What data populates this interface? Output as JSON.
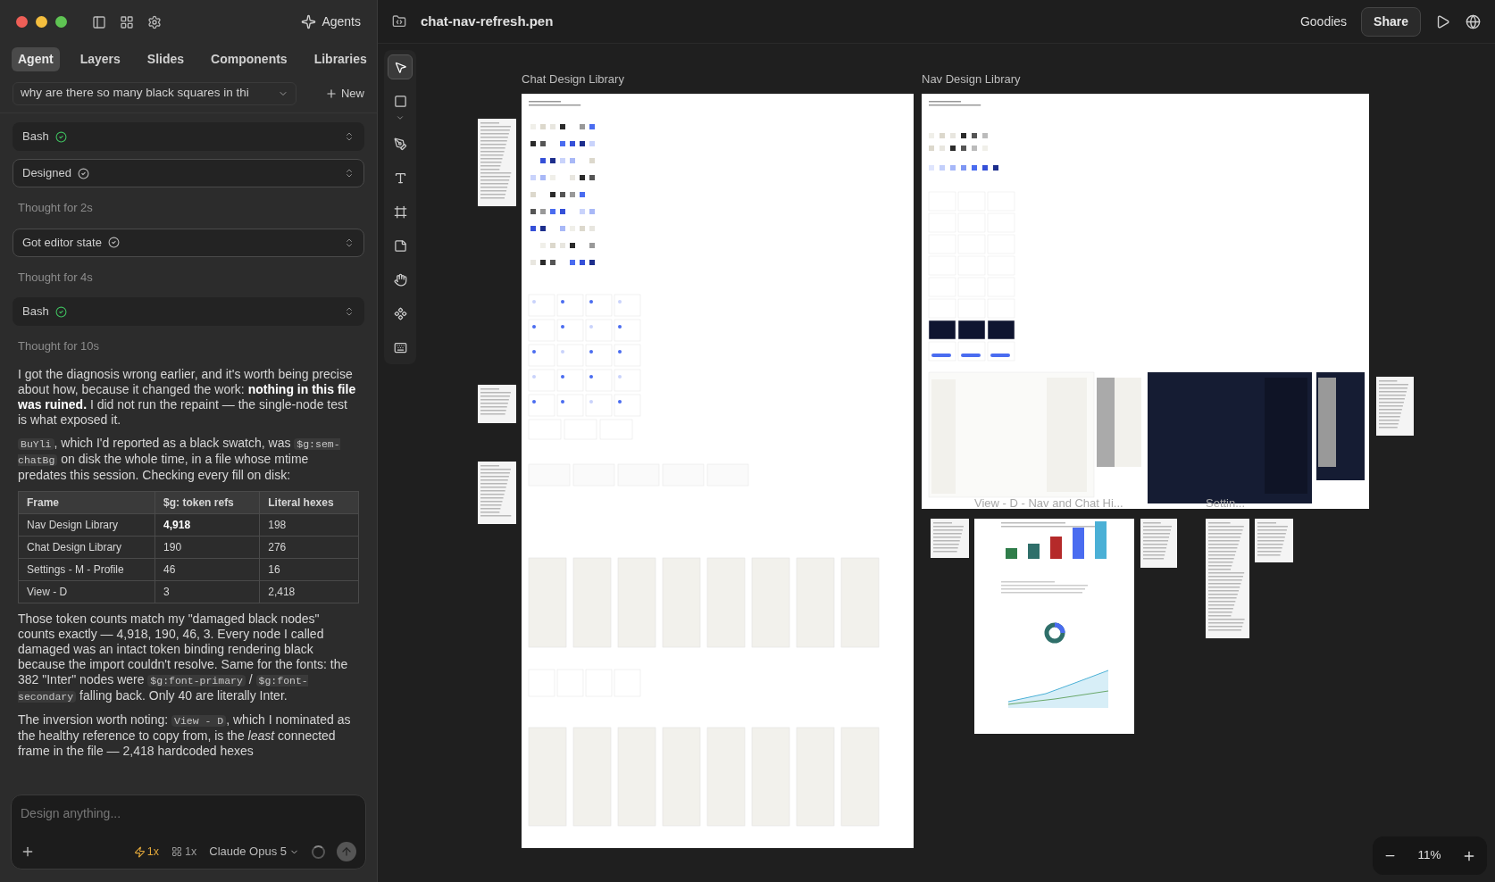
{
  "window": {
    "title": "chat-nav-refresh.pen"
  },
  "sidebar": {
    "agents_button": "Agents",
    "tabs": [
      {
        "label": "Agent",
        "selected": true
      },
      {
        "label": "Layers",
        "selected": false
      },
      {
        "label": "Slides",
        "selected": false
      },
      {
        "label": "Components",
        "selected": false
      },
      {
        "label": "Libraries",
        "selected": false
      }
    ],
    "conversation": {
      "title": "why are there so many black squares in thi",
      "new_button": "New"
    },
    "messages": [
      {
        "kind": "tool",
        "label": "Bash",
        "succeeded": true
      },
      {
        "kind": "tool",
        "label": "Designed",
        "succeeded": false
      },
      {
        "kind": "thought",
        "text": "Thought for 2s"
      },
      {
        "kind": "tool",
        "label": "Got editor state",
        "succeeded": false
      },
      {
        "kind": "thought",
        "text": "Thought for 4s"
      },
      {
        "kind": "tool",
        "label": "Bash",
        "succeeded": true
      },
      {
        "kind": "thought",
        "text": "Thought for 10s"
      },
      {
        "kind": "text",
        "parts": [
          {
            "kind": "text",
            "text": "I got the diagnosis wrong earlier, and it's worth being precise about how, because it changed the work: **nothing in this file was ruined.** I did not run the repaint — the single-node test is what exposed it."
          }
        ]
      },
      {
        "kind": "text",
        "parts": [
          {
            "kind": "code",
            "text": "BuYli"
          },
          {
            "kind": "text",
            "text": ", which I'd reported as a black swatch, was "
          },
          {
            "kind": "code",
            "text": "$g:sem-chatBg"
          },
          {
            "kind": "text",
            "text": " on disk the whole time, in a file whose mtime predates this session. Checking every fill on disk:"
          }
        ]
      },
      {
        "kind": "table",
        "columns": [
          "Frame",
          "$g: token refs",
          "Literal hexes"
        ],
        "rows": [
          [
            {
              "text": "Nav Design Library",
              "bold": false
            },
            {
              "text": "4,918",
              "bold": true
            },
            {
              "text": "198",
              "bold": false
            }
          ],
          [
            {
              "text": "Chat Design Library",
              "bold": false
            },
            {
              "text": "190",
              "bold": false
            },
            {
              "text": "276",
              "bold": false
            }
          ],
          [
            {
              "text": "Settings - M - Profile",
              "bold": false
            },
            {
              "text": "46",
              "bold": false
            },
            {
              "text": "16",
              "bold": false
            }
          ],
          [
            {
              "text": "View - D",
              "bold": false
            },
            {
              "text": "3",
              "bold": false
            },
            {
              "text": "2,418",
              "bold": false
            }
          ]
        ]
      },
      {
        "kind": "text",
        "parts": [
          {
            "kind": "text",
            "text": "Those token counts match my \"damaged black nodes\" counts exactly — 4,918, 190, 46, 3. Every node I called damaged was an intact token binding rendering black because the import couldn't resolve. Same for the fonts: the 382 \"Inter\" nodes were "
          },
          {
            "kind": "code",
            "text": "$g:font-primary"
          },
          {
            "kind": "text",
            "text": " / "
          },
          {
            "kind": "code",
            "text": "$g:font-secondary"
          },
          {
            "kind": "text",
            "text": " falling back. Only 40 are literally Inter."
          }
        ]
      },
      {
        "kind": "text",
        "parts": [
          {
            "kind": "text",
            "text": "The inversion worth noting: "
          },
          {
            "kind": "code",
            "text": "View - D"
          },
          {
            "kind": "text",
            "text": ", which I nominated as the healthy reference to copy from, is the *least* connected frame in the file — 2,418 hardcoded hexes"
          }
        ]
      }
    ],
    "composer": {
      "placeholder": "Design anything...",
      "speed": "1x",
      "variants": "1x",
      "model": "Claude Opus 5"
    }
  },
  "toolbar": {
    "tools": [
      {
        "kind": "select",
        "selected": true
      },
      {
        "kind": "rectangle",
        "selected": false
      },
      {
        "kind": "pen",
        "selected": false
      },
      {
        "kind": "text",
        "selected": false
      },
      {
        "kind": "frame",
        "selected": false
      },
      {
        "kind": "note",
        "selected": false
      },
      {
        "kind": "hand",
        "selected": false
      },
      {
        "kind": "component",
        "selected": false
      },
      {
        "kind": "keyboard",
        "selected": false
      }
    ]
  },
  "top_bar": {
    "goodies": "Goodies",
    "share": "Share"
  },
  "canvas": {
    "frames": [
      {
        "label": "Chat Design Library",
        "kind": "chat"
      },
      {
        "label": "Nav Design Library",
        "kind": "nav",
        "overlay_labels": [
          "View - D - Nav and Chat Hi...",
          "Settin..."
        ]
      }
    ],
    "zoom": "11%"
  }
}
